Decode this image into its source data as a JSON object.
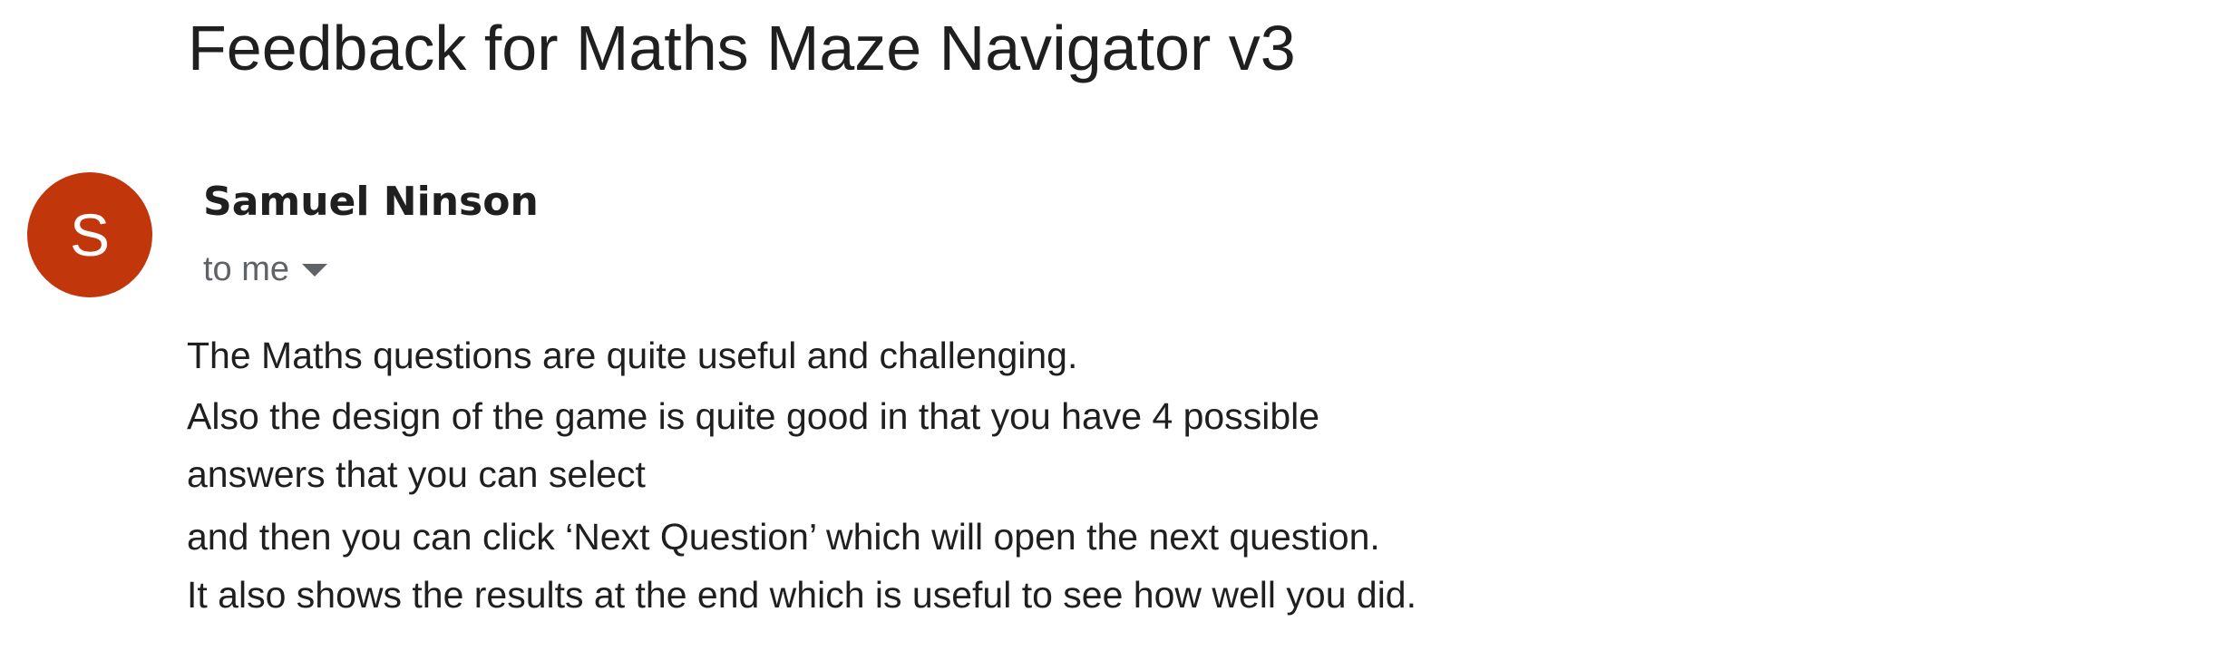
{
  "email": {
    "subject": "Feedback for Maths Maze Navigator v3",
    "sender": {
      "name": "Samuel Ninson",
      "avatar_initial": "S",
      "avatar_color": "#c1360b"
    },
    "recipient_label": "to me",
    "recipient_toggle_icon": "caret-down-icon",
    "body_lines": [
      "The Maths questions are quite useful and challenging.",
      "Also the design of the game is quite good in that you have 4 possible",
      "answers that you can select",
      "and then you can click ‘Next Question’ which will open the next question.",
      "It also shows the results at the end which is useful to see how well you did."
    ]
  }
}
